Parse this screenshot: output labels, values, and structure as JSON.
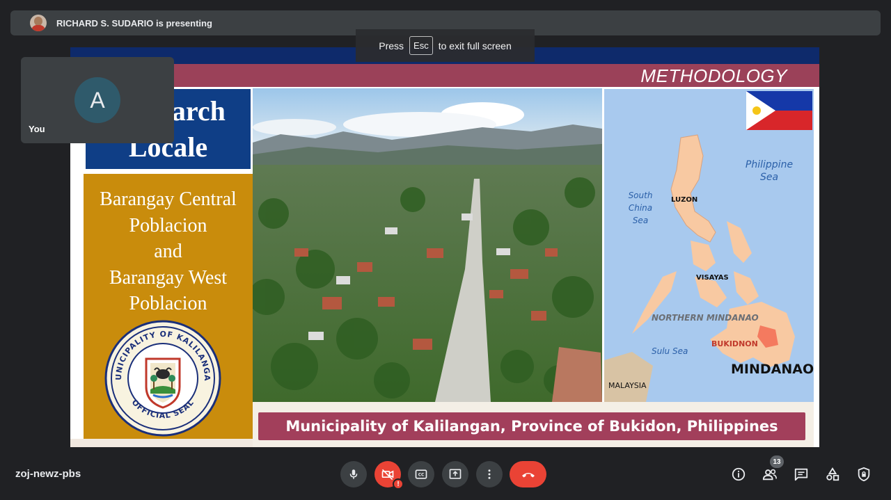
{
  "presenter": {
    "text": "RICHARD S. SUDARIO is presenting"
  },
  "notice": {
    "press": "Press",
    "key": "Esc",
    "rest": "to exit full screen"
  },
  "self": {
    "initial": "A",
    "label": "You"
  },
  "slide": {
    "title": "METHODOLOGY",
    "locale_lines": [
      "earch",
      "Locale"
    ],
    "barangay_lines": [
      "Barangay Central",
      "Poblacion",
      "and",
      "Barangay West",
      "Poblacion"
    ],
    "seal_top_text": "MUNICIPALITY OF KALILANGAN",
    "seal_bottom_text": "OFFICIAL SEAL",
    "map_labels": {
      "philippine_sea": "Philippine Sea",
      "south_china_sea": "South China Sea",
      "luzon": "LUZON",
      "visayas": "VISAYAS",
      "northern_mindanao": "NORTHERN MINDANAO",
      "sulu_sea": "Sulu Sea",
      "bukidnon": "BUKIDNON",
      "mindanao": "MINDANAO",
      "malaysia": "MALAYSIA"
    },
    "caption": "Municipality of Kalilangan, Province of Bukidon, Philippines"
  },
  "toolbar": {
    "meeting_code": "zoj-newz-pbs",
    "participants_count": "13"
  },
  "colors": {
    "background": "#202124",
    "control": "#3c4043",
    "danger": "#ea4335",
    "title_band": "#9b4159",
    "locale_blue": "#0f3e86",
    "barangay_gold": "#c98c0c"
  }
}
